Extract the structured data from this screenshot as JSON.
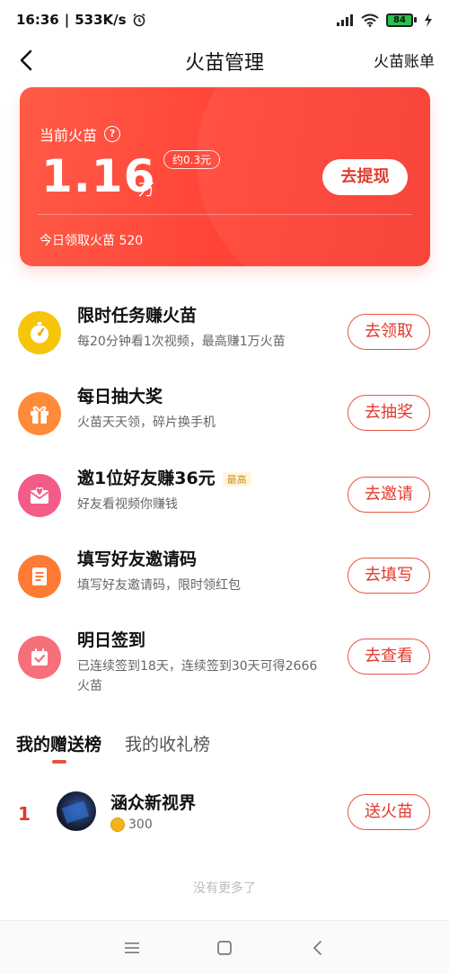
{
  "status_bar": {
    "time": "16:36",
    "speed": "533K/s",
    "battery": "84",
    "battery_color": "#2bc04a"
  },
  "header": {
    "back_icon": "chevron-left-icon",
    "title": "火苗管理",
    "bill_link": "火苗账单"
  },
  "card": {
    "label": "当前火苗",
    "help_icon": "question-circle-icon",
    "amount": "1.16",
    "unit": "万",
    "approx": "约0.3元",
    "withdraw_label": "去提现",
    "today_text": "今日领取火苗 520",
    "gradient": [
      "#ff5b47",
      "#f73a2e"
    ]
  },
  "tasks": [
    {
      "title": "限时任务赚火苗",
      "desc": "每20分钟看1次视频，最高赚1万火苗",
      "button": "去领取",
      "icon": "stopwatch-icon",
      "icon_color": "#f6c409"
    },
    {
      "title": "每日抽大奖",
      "desc": "火苗天天领，碎片换手机",
      "button": "去抽奖",
      "icon": "gift-icon",
      "icon_color": "#ff8a3a"
    },
    {
      "title": "邀1位好友赚36元",
      "tag": "最高",
      "desc": "好友看视频你赚钱",
      "button": "去邀请",
      "icon": "envelope-heart-icon",
      "icon_color": "#f35c87"
    },
    {
      "title": "填写好友邀请码",
      "desc": "填写好友邀请码，限时领红包",
      "button": "去填写",
      "icon": "document-icon",
      "icon_color": "#ff7b35"
    },
    {
      "title": "明日签到",
      "desc": "已连续签到18天，连续签到30天可得2666火苗",
      "button": "去查看",
      "icon": "calendar-check-icon",
      "icon_color": "#f6707c"
    }
  ],
  "tabs": [
    {
      "label": "我的赠送榜",
      "active": true
    },
    {
      "label": "我的收礼榜",
      "active": false
    }
  ],
  "ranking": [
    {
      "rank": "1",
      "name": "涵众新视界",
      "coins": "300",
      "button": "送火苗"
    }
  ],
  "footer": {
    "no_more": "没有更多了"
  },
  "nav_bar": {
    "menu_icon": "menu-icon",
    "home_icon": "home-square-icon",
    "back_icon": "back-triangle-icon"
  },
  "accent_color": "#e23a2c"
}
